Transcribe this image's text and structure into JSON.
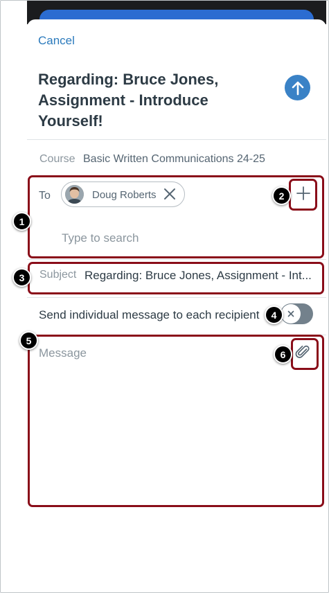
{
  "header": {
    "cancel_label": "Cancel",
    "title": "Regarding: Bruce Jones, Assignment - Introduce Yourself!",
    "send_icon": "arrow-up-icon"
  },
  "course": {
    "label": "Course",
    "value": "Basic Written Communications 24-25"
  },
  "to": {
    "label": "To",
    "recipients": [
      {
        "name": "Doug Roberts"
      }
    ],
    "search_placeholder": "Type to search"
  },
  "subject": {
    "label": "Subject",
    "value": "Regarding: Bruce Jones, Assignment - Int..."
  },
  "individual_message": {
    "label": "Send individual message to each recipient",
    "enabled": false
  },
  "message": {
    "placeholder": "Message",
    "attach_icon": "paperclip-icon"
  },
  "callouts": [
    "1",
    "2",
    "3",
    "4",
    "5",
    "6"
  ],
  "colors": {
    "accent": "#2b7abc",
    "send_button": "#3a82c6",
    "highlight": "#8a0d19",
    "toggle_off": "#73818c"
  }
}
